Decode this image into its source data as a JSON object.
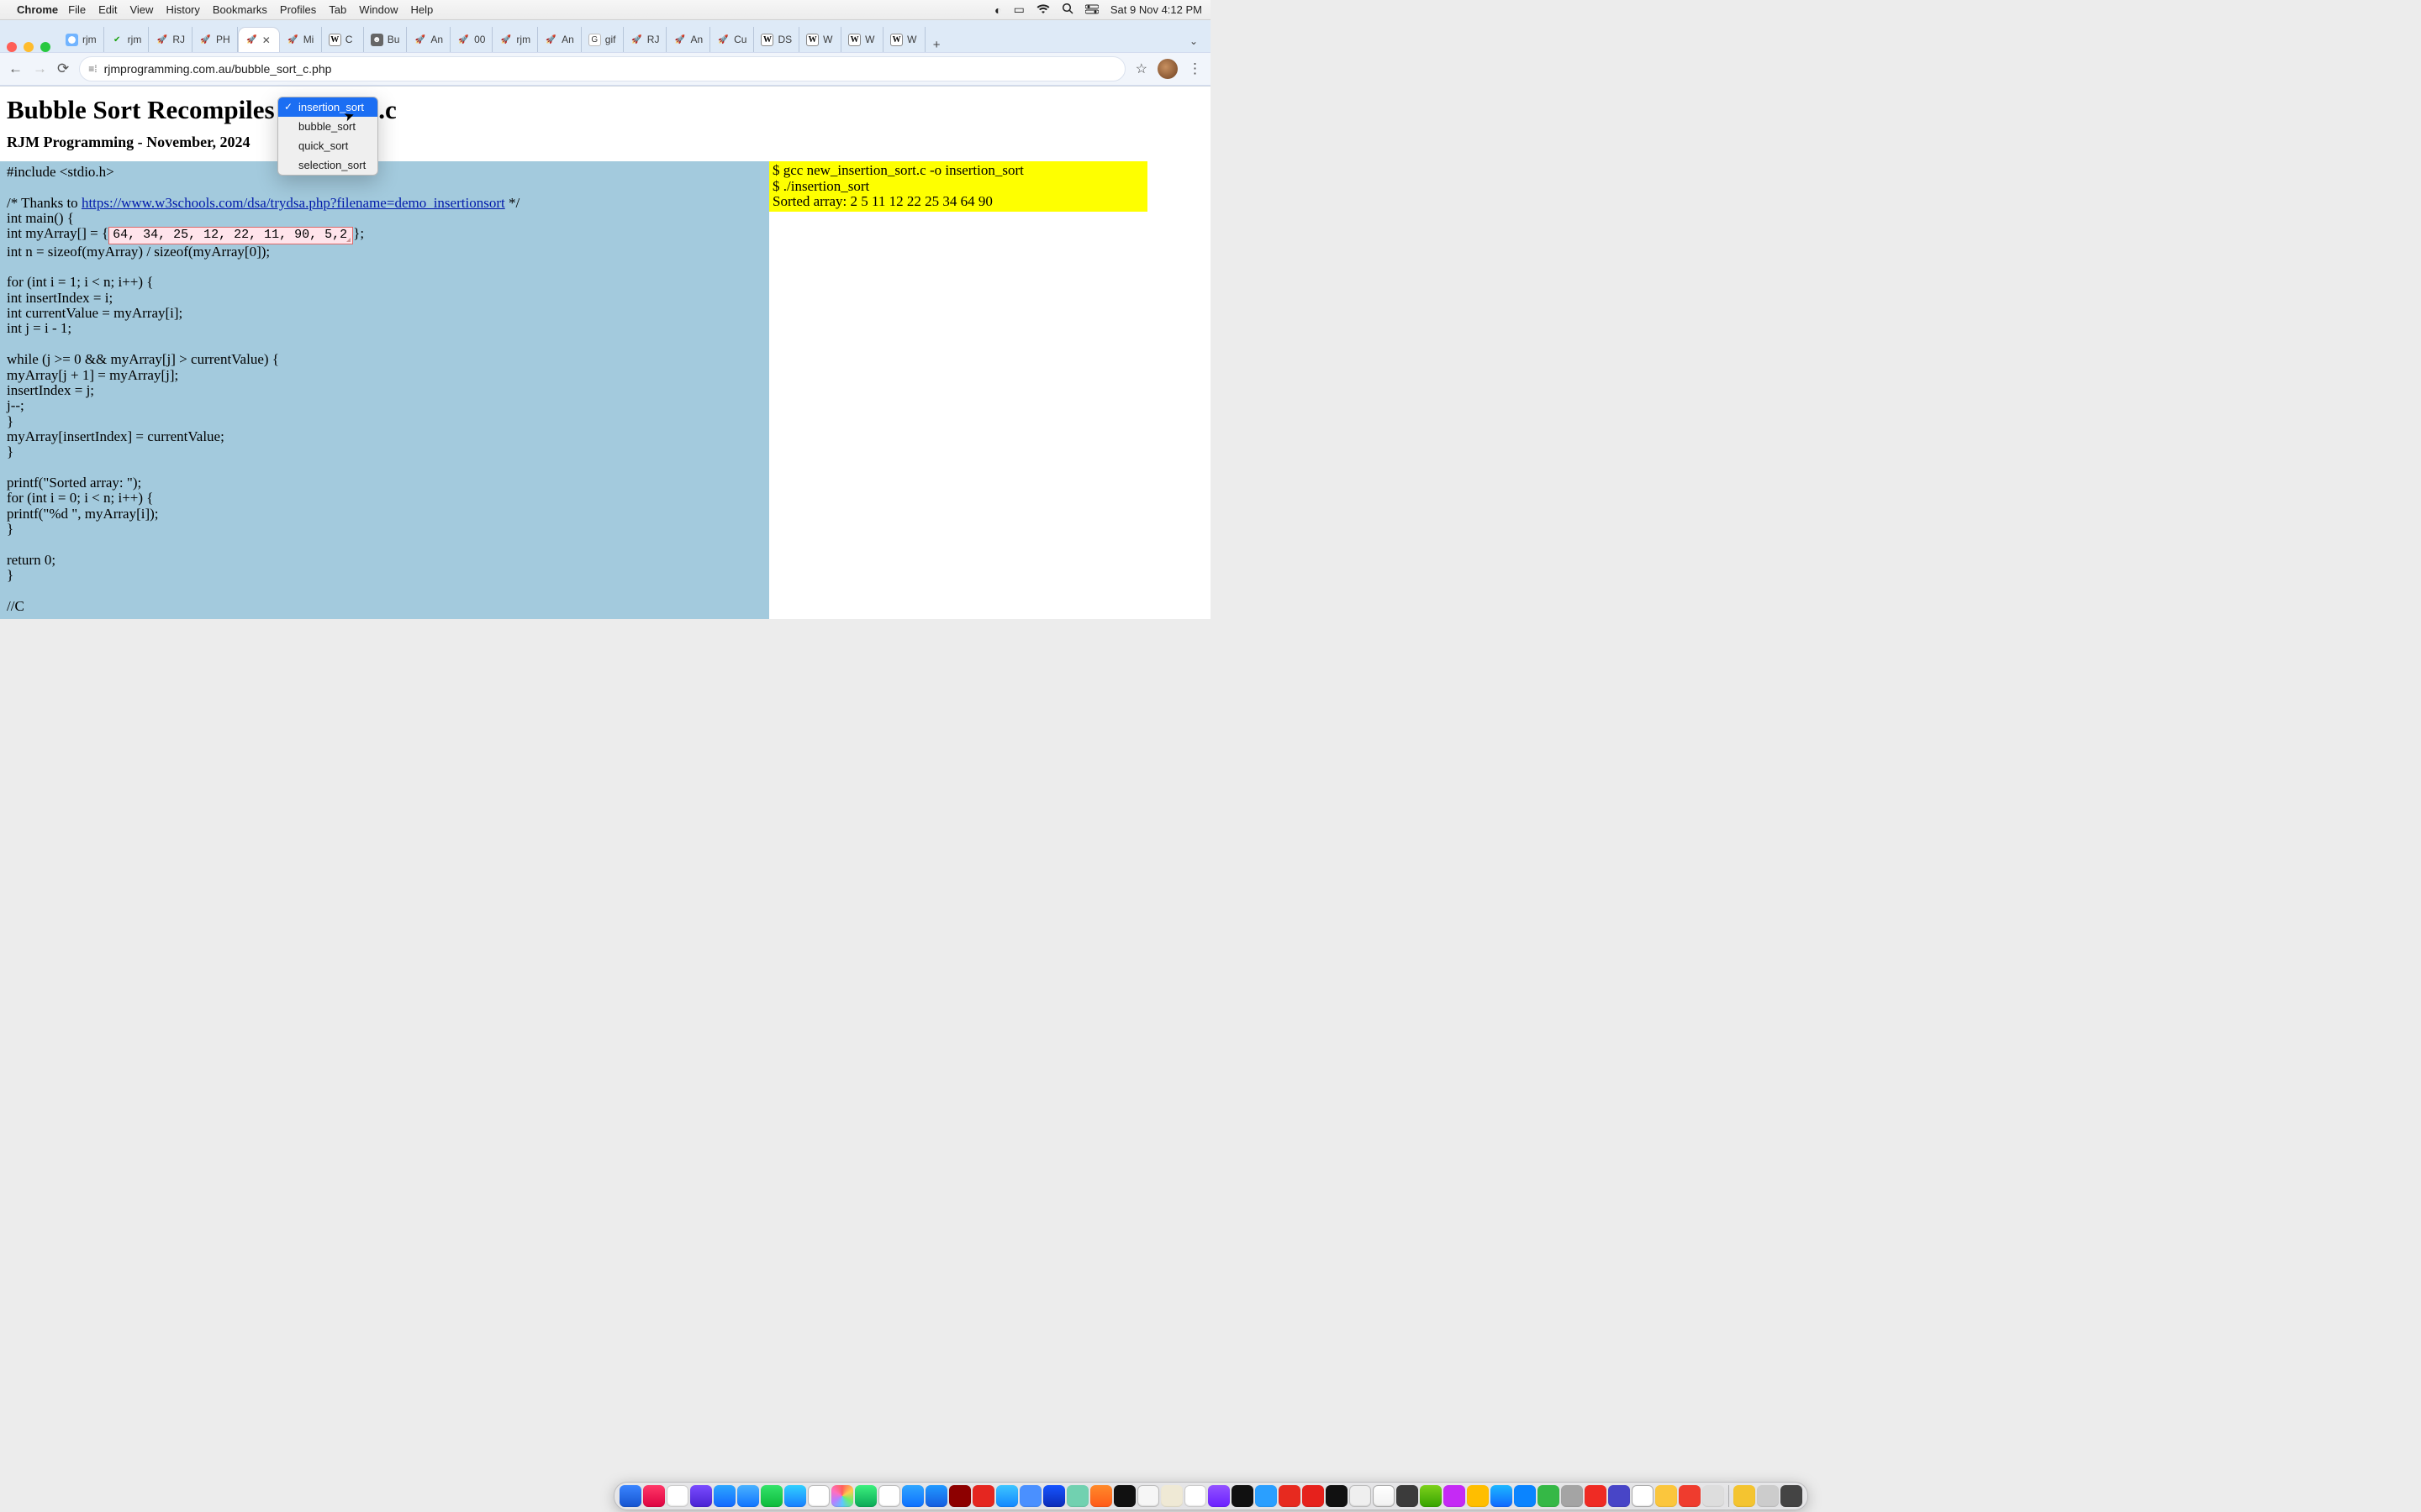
{
  "menubar": {
    "app": "Chrome",
    "items": [
      "File",
      "Edit",
      "View",
      "History",
      "Bookmarks",
      "Profiles",
      "Tab",
      "Window",
      "Help"
    ],
    "clock": "Sat 9 Nov  4:12 PM"
  },
  "tabs": {
    "list": [
      {
        "label": "rjm",
        "favClass": "fav-r"
      },
      {
        "label": "rjm",
        "favClass": "fav-ck"
      },
      {
        "label": "RJ",
        "favClass": "fav-rocket"
      },
      {
        "label": "PH",
        "favClass": "fav-rocket"
      },
      {
        "label": "",
        "favClass": "fav-rocket",
        "active": true
      },
      {
        "label": "Mi",
        "favClass": "fav-rocket"
      },
      {
        "label": "C",
        "favClass": "fav-wiki"
      },
      {
        "label": "Bu",
        "favClass": "fav-bu"
      },
      {
        "label": "An",
        "favClass": "fav-rocket"
      },
      {
        "label": "00",
        "favClass": "fav-rocket"
      },
      {
        "label": "rjm",
        "favClass": "fav-rocket"
      },
      {
        "label": "An",
        "favClass": "fav-rocket"
      },
      {
        "label": "gif",
        "favClass": "fav-g"
      },
      {
        "label": "RJ",
        "favClass": "fav-rocket"
      },
      {
        "label": "An",
        "favClass": "fav-rocket"
      },
      {
        "label": "Cu",
        "favClass": "fav-rocket"
      },
      {
        "label": "DS",
        "favClass": "fav-wiki"
      },
      {
        "label": "W",
        "favClass": "fav-wiki"
      },
      {
        "label": "W",
        "favClass": "fav-wiki"
      },
      {
        "label": "W",
        "favClass": "fav-wiki"
      }
    ],
    "newtab": "+",
    "overflow": "⌄"
  },
  "toolbar": {
    "back": "←",
    "fwd": "→",
    "reload": "⟳",
    "siteicon": "⟮⚙⟯",
    "url": "rjmprogramming.com.au/bubble_sort_c.php",
    "star": "☆",
    "menu": "⋮"
  },
  "page": {
    "h1": "Bubble Sort Recompiles",
    "h1_suffix": ".c",
    "h3": "RJM Programming - November, 2024",
    "dropdown": {
      "selected": "insertion_sort",
      "options": [
        "insertion_sort",
        "bubble_sort",
        "quick_sort",
        "selection_sort"
      ]
    },
    "code": {
      "l1": "#include <stdio.h>",
      "l2": "",
      "l3_pre": "/* Thanks to ",
      "l3_link": "https://www.w3schools.com/dsa/trydsa.php?filename=demo_insertionsort",
      "l3_post": " */",
      "l4": "int main() {",
      "l5_pre": "int myArray[] = {",
      "l5_val": "64, 34, 25, 12, 22, 11, 90, 5,2",
      "l5_post": "};",
      "l6": "int n = sizeof(myArray) / sizeof(myArray[0]);",
      "l7": "",
      "l8": "for (int i = 1; i < n; i++) {",
      "l9": "int insertIndex = i;",
      "l10": "int currentValue = myArray[i];",
      "l11": "int j = i - 1;",
      "l12": "",
      "l13": "while (j >= 0 && myArray[j] > currentValue) {",
      "l14": "myArray[j + 1] = myArray[j];",
      "l15": "insertIndex = j;",
      "l16": "j--;",
      "l17": "}",
      "l18": "myArray[insertIndex] = currentValue;",
      "l19": "}",
      "l20": "",
      "l21": "printf(\"Sorted array: \");",
      "l22": "for (int i = 0; i < n; i++) {",
      "l23": "printf(\"%d \", myArray[i]);",
      "l24": "}",
      "l25": "",
      "l26": "return 0;",
      "l27": "}",
      "l28": "",
      "l29": "//C"
    },
    "output": {
      "l1": "$ gcc new_insertion_sort.c -o insertion_sort",
      "l2": "$ ./insertion_sort",
      "l3": "Sorted array: 2 5 11 12 22 25 34 64 90"
    }
  }
}
